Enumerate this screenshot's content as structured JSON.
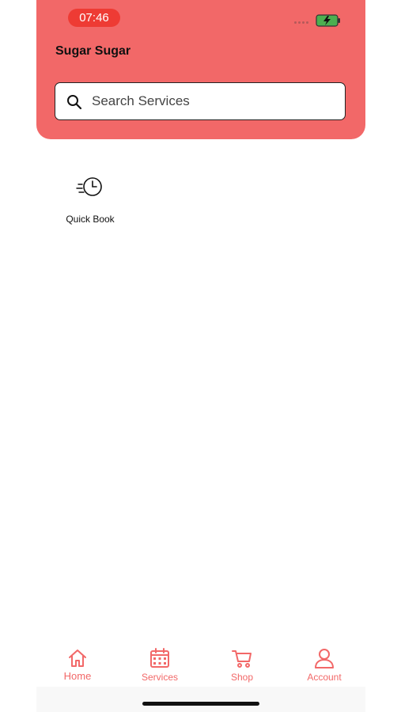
{
  "status_bar": {
    "time": "07:46",
    "battery_icon": "battery-charging-icon"
  },
  "header": {
    "title": "Sugar Sugar"
  },
  "search": {
    "placeholder": "Search Services",
    "value": "",
    "icon": "search-icon"
  },
  "quick_actions": [
    {
      "label": "Quick Book",
      "icon": "fast-clock-icon"
    }
  ],
  "tabs": [
    {
      "label": "Home",
      "icon": "home-icon"
    },
    {
      "label": "Services",
      "icon": "calendar-icon"
    },
    {
      "label": "Shop",
      "icon": "cart-icon"
    },
    {
      "label": "Account",
      "icon": "user-icon"
    }
  ],
  "colors": {
    "brand": "#f26868",
    "time_pill": "#ee3b34",
    "battery": "#4caf50"
  }
}
